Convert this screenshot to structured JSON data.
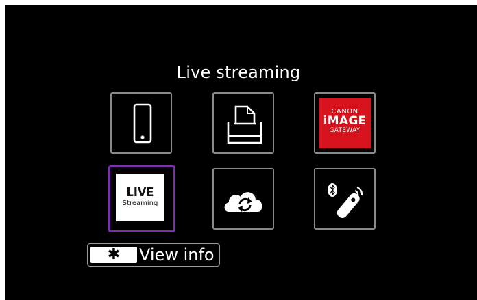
{
  "screen": {
    "title": "Live streaming",
    "tiles": [
      {
        "name": "smartphone",
        "icon": "smartphone-icon"
      },
      {
        "name": "printer",
        "icon": "printer-icon"
      },
      {
        "name": "image-gateway",
        "icon": "canon-image-gateway-logo",
        "logo_lines": [
          "CANON",
          "iMAGE",
          "GATEWAY"
        ]
      },
      {
        "name": "live-streaming",
        "icon": "live-streaming-logo",
        "logo_lines": [
          "LIVE",
          "Streaming"
        ],
        "selected": true
      },
      {
        "name": "cloud-sync",
        "icon": "cloud-sync-icon"
      },
      {
        "name": "bluetooth-remote",
        "icon": "bluetooth-remote-icon"
      }
    ],
    "view_info": {
      "key_symbol": "✱",
      "label": "View info"
    }
  },
  "colors": {
    "background": "#000000",
    "selection": "#7b2fa8",
    "image_gateway_red": "#d6121c",
    "tile_border": "#8a8a8a"
  }
}
